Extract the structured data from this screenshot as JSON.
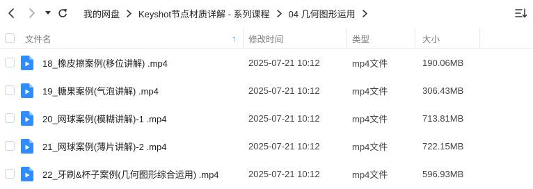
{
  "toolbar": {
    "back_icon": "chevron-left-icon",
    "forward_icon": "chevron-right-icon",
    "dropdown_icon": "caret-down-icon",
    "refresh_icon": "refresh-icon",
    "sort_icon": "sort-list-icon",
    "breadcrumbs": [
      "我的网盘",
      "Keyshot节点材质详解 - 系列课程",
      "04 几何图形运用"
    ]
  },
  "columns": {
    "name": "文件名",
    "modified": "修改时间",
    "type": "类型",
    "size": "大小",
    "sort_indicator": "↑"
  },
  "files": [
    {
      "name": "18_橡皮擦案例(移位讲解) .mp4",
      "modified": "2025-07-21 10:12",
      "type": "mp4文件",
      "size": "190.06MB"
    },
    {
      "name": "19_糖果案例(气泡讲解) .mp4",
      "modified": "2025-07-21 10:12",
      "type": "mp4文件",
      "size": "306.43MB"
    },
    {
      "name": "20_网球案例(模糊讲解)-1 .mp4",
      "modified": "2025-07-21 10:12",
      "type": "mp4文件",
      "size": "713.81MB"
    },
    {
      "name": "21_网球案例(薄片讲解)-2 .mp4",
      "modified": "2025-07-21 10:12",
      "type": "mp4文件",
      "size": "722.15MB"
    },
    {
      "name": "22_牙刷&杯子案例(几何图形综合运用) .mp4",
      "modified": "2025-07-21 10:12",
      "type": "mp4文件",
      "size": "596.93MB"
    }
  ],
  "colors": {
    "icon_blue": "#2f8cff",
    "sort_arrow": "#2f8cff"
  }
}
